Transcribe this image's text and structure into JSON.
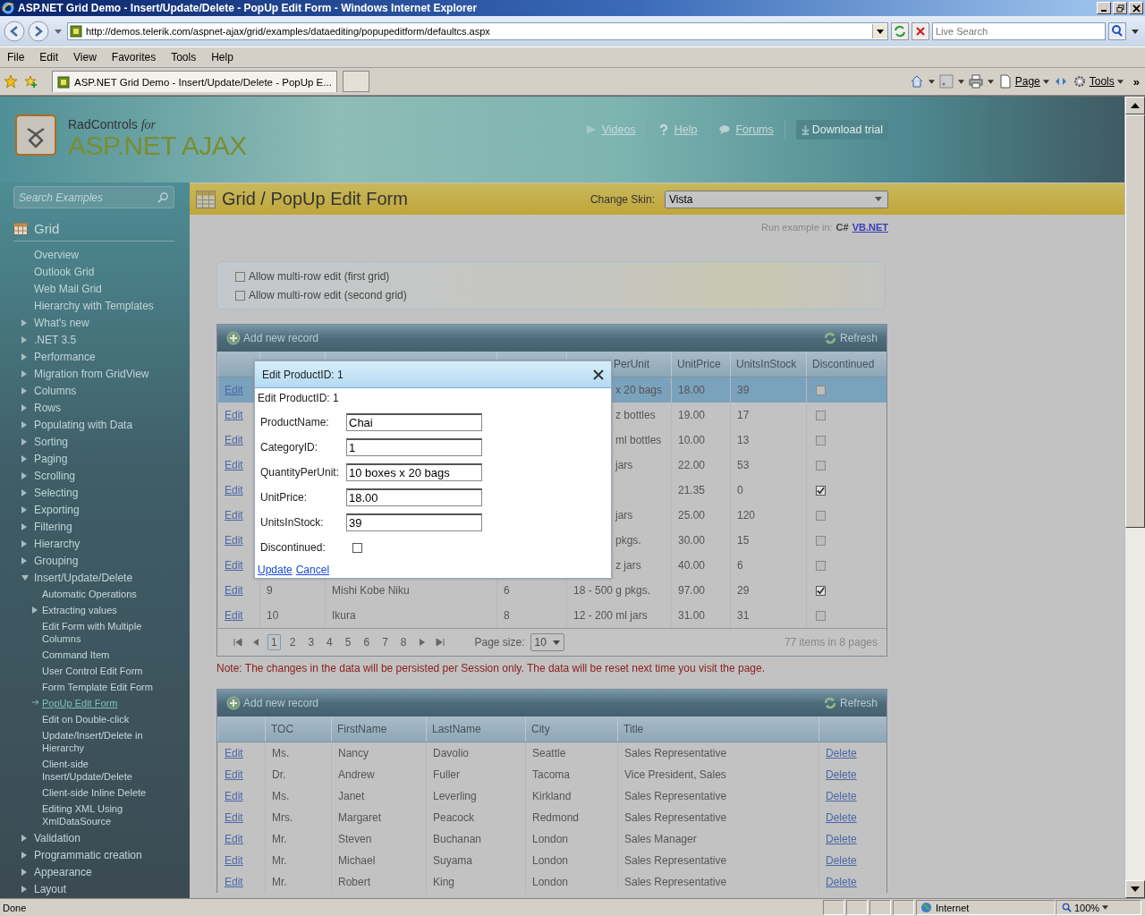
{
  "window": {
    "title": "ASP.NET Grid Demo - Insert/Update/Delete - PopUp Edit Form - Windows Internet Explorer"
  },
  "address_bar": {
    "url": "http://demos.telerik.com/aspnet-ajax/grid/examples/dataediting/popupeditform/defaultcs.aspx"
  },
  "search": {
    "placeholder": "Live Search"
  },
  "menu": [
    "File",
    "Edit",
    "View",
    "Favorites",
    "Tools",
    "Help"
  ],
  "tabs": [
    {
      "label": "ASP.NET Grid Demo - Insert/Update/Delete - PopUp E...",
      "selected": true
    }
  ],
  "command_bar": {
    "page": "Page",
    "tools": "Tools",
    "more": "»"
  },
  "banner": {
    "brand_small": "RadControls",
    "brand_for": "for",
    "brand_large": "ASP.NET AJAX",
    "links": [
      "Videos",
      "Help",
      "Forums"
    ],
    "download": "Download trial"
  },
  "sidebar": {
    "search_placeholder": "Search Examples",
    "section": "Grid",
    "items": [
      {
        "label": "Overview",
        "selected": false
      },
      {
        "label": "Outlook Grid",
        "selected": false
      },
      {
        "label": "Web Mail Grid",
        "selected": false
      },
      {
        "label": "Hierarchy with Templates",
        "selected": false
      },
      {
        "label": "What's new",
        "selected": false,
        "expanded": false
      },
      {
        "label": ".NET 3.5",
        "selected": false,
        "expanded": false
      },
      {
        "label": "Performance",
        "selected": false,
        "expanded": false
      },
      {
        "label": "Migration from GridView",
        "selected": false,
        "expanded": false
      },
      {
        "label": "Columns",
        "selected": false,
        "expanded": false
      },
      {
        "label": "Rows",
        "selected": false,
        "expanded": false
      },
      {
        "label": "Populating with Data",
        "selected": false,
        "expanded": false
      },
      {
        "label": "Sorting",
        "selected": false,
        "expanded": false
      },
      {
        "label": "Paging",
        "selected": false,
        "expanded": false
      },
      {
        "label": "Scrolling",
        "selected": false,
        "expanded": false
      },
      {
        "label": "Selecting",
        "selected": false,
        "expanded": false
      },
      {
        "label": "Exporting",
        "selected": false,
        "expanded": false
      },
      {
        "label": "Filtering",
        "selected": false,
        "expanded": false
      },
      {
        "label": "Hierarchy",
        "selected": false,
        "expanded": false
      },
      {
        "label": "Grouping",
        "selected": false,
        "expanded": false
      },
      {
        "label": "Insert/Update/Delete",
        "selected": false,
        "expanded": true,
        "children": [
          {
            "label": "Automatic Operations",
            "selected": false
          },
          {
            "label": "Extracting values",
            "selected": false,
            "expanded": false
          },
          {
            "label": "Edit Form with Multiple Columns",
            "selected": false
          },
          {
            "label": "Command Item",
            "selected": false
          },
          {
            "label": "User Control Edit Form",
            "selected": false
          },
          {
            "label": "Form Template Edit Form",
            "selected": false
          },
          {
            "label": "PopUp Edit Form",
            "selected": true
          },
          {
            "label": "Edit on Double-click",
            "selected": false
          },
          {
            "label": "Update/Insert/Delete in Hierarchy",
            "selected": false
          },
          {
            "label": "Client-side Insert/Update/Delete",
            "selected": false
          },
          {
            "label": "Client-side Inline Delete",
            "selected": false
          },
          {
            "label": "Editing XML Using XmlDataSource",
            "selected": false
          }
        ]
      },
      {
        "label": "Validation",
        "selected": false,
        "expanded": false
      },
      {
        "label": "Programmatic creation",
        "selected": false,
        "expanded": false
      },
      {
        "label": "Appearance",
        "selected": false,
        "expanded": false
      },
      {
        "label": "Layout",
        "selected": false,
        "expanded": false
      }
    ]
  },
  "page": {
    "title": "Grid / PopUp Edit Form",
    "skin_label": "Change Skin:",
    "skin_value": "Vista",
    "run_label": "Run example in:",
    "run_current": "C#",
    "run_link": "VB.NET"
  },
  "options": [
    {
      "label": "Allow multi-row edit (first grid)",
      "checked": false
    },
    {
      "label": "Allow multi-row edit (second grid)",
      "checked": false
    }
  ],
  "grid1": {
    "add": "Add new record",
    "refresh": "Refresh",
    "columns": [
      "PerUnit",
      "UnitPrice",
      "UnitsInStock",
      "Discontinued"
    ],
    "rows": [
      {
        "kind": "covered",
        "edit": "Edit",
        "quantity": "x 20 bags",
        "price": "18.00",
        "stock": "39",
        "discontinued": false,
        "selected": true
      },
      {
        "kind": "covered",
        "edit": "Edit",
        "quantity": "z bottles",
        "price": "19.00",
        "stock": "17",
        "discontinued": false,
        "selected": false
      },
      {
        "kind": "covered",
        "edit": "Edit",
        "quantity": "ml bottles",
        "price": "10.00",
        "stock": "13",
        "discontinued": false,
        "selected": false
      },
      {
        "kind": "covered",
        "edit": "Edit",
        "quantity": "jars",
        "price": "22.00",
        "stock": "53",
        "discontinued": false,
        "selected": false
      },
      {
        "kind": "covered",
        "edit": "Edit",
        "price": "21.35",
        "stock": "0",
        "discontinued": true,
        "selected": false
      },
      {
        "kind": "covered",
        "edit": "Edit",
        "quantity": "jars",
        "price": "25.00",
        "stock": "120",
        "discontinued": false,
        "selected": false
      },
      {
        "kind": "covered",
        "edit": "Edit",
        "quantity": "pkgs.",
        "price": "30.00",
        "stock": "15",
        "discontinued": false,
        "selected": false
      },
      {
        "kind": "covered",
        "edit": "Edit",
        "quantity": "z jars",
        "price": "40.00",
        "stock": "6",
        "discontinued": false,
        "selected": false
      },
      {
        "kind": "full",
        "edit": "Edit",
        "id": "9",
        "name": "Mishi Kobe Niku",
        "category": "6",
        "quantity": "18 - 500 g pkgs.",
        "price": "97.00",
        "stock": "29",
        "discontinued": true,
        "selected": false
      },
      {
        "kind": "full",
        "edit": "Edit",
        "id": "10",
        "name": "Ikura",
        "category": "8",
        "quantity": "12 - 200 ml jars",
        "price": "31.00",
        "stock": "31",
        "discontinued": false,
        "selected": false
      }
    ],
    "pager": {
      "pages": [
        {
          "label": "1",
          "selected": true
        },
        {
          "label": "2",
          "selected": false
        },
        {
          "label": "3",
          "selected": false
        },
        {
          "label": "4",
          "selected": false
        },
        {
          "label": "5",
          "selected": false
        },
        {
          "label": "6",
          "selected": false
        },
        {
          "label": "7",
          "selected": false
        },
        {
          "label": "8",
          "selected": false
        }
      ],
      "page_size_label": "Page size:",
      "page_size": "10",
      "summary": "77 items in 8 pages"
    }
  },
  "note": "Note: The changes in the data will be persisted per Session only. The data will be reset next time you visit the page.",
  "popup": {
    "title": "Edit ProductID: 1",
    "heading": "Edit ProductID: 1",
    "fields": [
      {
        "label": "ProductName:",
        "value": "Chai"
      },
      {
        "label": "CategoryID:",
        "value": "1"
      },
      {
        "label": "QuantityPerUnit:",
        "value": "10 boxes x 20 bags"
      },
      {
        "label": "UnitPrice:",
        "value": "18.00"
      },
      {
        "label": "UnitsInStock:",
        "value": "39"
      }
    ],
    "discontinued": {
      "label": "Discontinued:",
      "checked": false
    },
    "update": "Update",
    "cancel": "Cancel"
  },
  "grid2": {
    "add": "Add new record",
    "refresh": "Refresh",
    "columns": [
      "TOC",
      "FirstName",
      "LastName",
      "City",
      "Title"
    ],
    "rows": [
      {
        "edit": "Edit",
        "toc": "Ms.",
        "first": "Nancy",
        "last": "Davolio",
        "city": "Seattle",
        "title": "Sales Representative",
        "delete": "Delete"
      },
      {
        "edit": "Edit",
        "toc": "Dr.",
        "first": "Andrew",
        "last": "Fuller",
        "city": "Tacoma",
        "title": "Vice President, Sales",
        "delete": "Delete"
      },
      {
        "edit": "Edit",
        "toc": "Ms.",
        "first": "Janet",
        "last": "Leverling",
        "city": "Kirkland",
        "title": "Sales Representative",
        "delete": "Delete"
      },
      {
        "edit": "Edit",
        "toc": "Mrs.",
        "first": "Margaret",
        "last": "Peacock",
        "city": "Redmond",
        "title": "Sales Representative",
        "delete": "Delete"
      },
      {
        "edit": "Edit",
        "toc": "Mr.",
        "first": "Steven",
        "last": "Buchanan",
        "city": "London",
        "title": "Sales Manager",
        "delete": "Delete"
      },
      {
        "edit": "Edit",
        "toc": "Mr.",
        "first": "Michael",
        "last": "Suyama",
        "city": "London",
        "title": "Sales Representative",
        "delete": "Delete"
      },
      {
        "edit": "Edit",
        "toc": "Mr.",
        "first": "Robert",
        "last": "King",
        "city": "London",
        "title": "Sales Representative",
        "delete": "Delete"
      }
    ]
  },
  "status_bar": {
    "text": "Done",
    "zone": "Internet",
    "zoom": "100%"
  }
}
